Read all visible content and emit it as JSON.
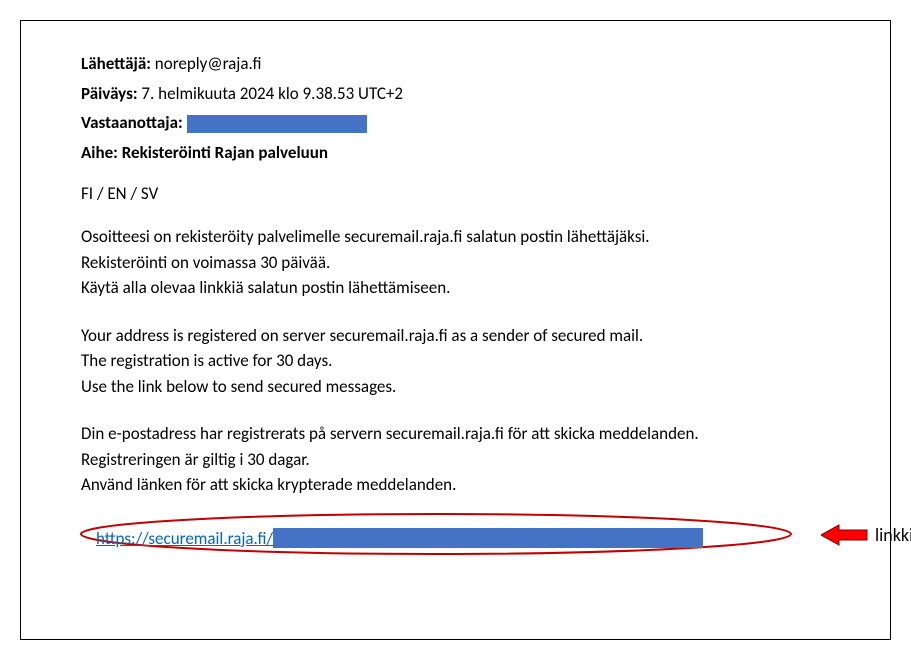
{
  "header": {
    "from_label": "Lähettäjä:",
    "from_value": " noreply@raja.fi",
    "date_label": "Päiväys:",
    "date_value": " 7. helmikuuta 2024 klo 9.38.53 UTC+2",
    "to_label": "Vastaanottaja: ",
    "subject_label": "Aihe: ",
    "subject_value": "Rekisteröinti Rajan palveluun"
  },
  "lang_indicator": "FI / EN / SV",
  "body_fi": {
    "line1": "Osoitteesi on rekisteröity palvelimelle securemail.raja.fi salatun postin lähettäjäksi.",
    "line2": "Rekisteröinti on voimassa 30 päivää.",
    "line3": "Käytä alla olevaa linkkiä salatun postin lähettämiseen."
  },
  "body_en": {
    "line1": "Your address is registered on server securemail.raja.fi as a sender of secured mail.",
    "line2": "The registration is active for 30 days.",
    "line3": "Use the link below to send secured messages."
  },
  "body_sv": {
    "line1": "Din e-postadress har registrerats på servern securemail.raja.fi för att skicka meddelanden.",
    "line2": "Registreringen är giltig i 30 dagar.",
    "line3": "Använd länken för att skicka krypterade meddelanden."
  },
  "link": {
    "visible_text": "https://securemail.raja.fi/"
  },
  "annotation": {
    "label": "linkki"
  },
  "colors": {
    "redaction": "#4472c4",
    "link": "#0563c1",
    "circle": "#c00000",
    "arrow_fill": "#ff0000",
    "arrow_stroke": "#800000"
  }
}
